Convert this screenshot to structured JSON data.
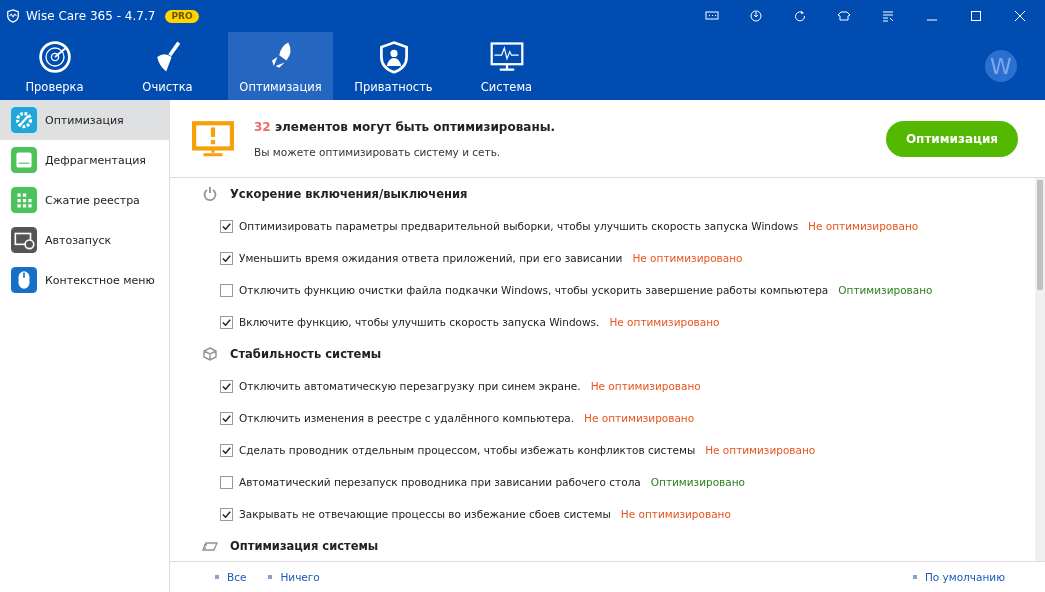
{
  "window": {
    "title": "Wise Care 365 - 4.7.7",
    "badge": "PRO"
  },
  "nav": [
    {
      "label": "Проверка",
      "selected": false
    },
    {
      "label": "Очистка",
      "selected": false
    },
    {
      "label": "Оптимизация",
      "selected": true
    },
    {
      "label": "Приватность",
      "selected": false
    },
    {
      "label": "Система",
      "selected": false
    }
  ],
  "avatar": {
    "letter": "W"
  },
  "sidebar": {
    "items": [
      {
        "label": "Оптимизация",
        "color": "#1ea7d8",
        "selected": true
      },
      {
        "label": "Дефрагментация",
        "color": "#4cc35a",
        "selected": false
      },
      {
        "label": "Сжатие реестра",
        "color": "#4cc35a",
        "selected": false
      },
      {
        "label": "Автозапуск",
        "color": "#555555",
        "selected": false
      },
      {
        "label": "Контекстное меню",
        "color": "#1670c8",
        "selected": false
      }
    ]
  },
  "header": {
    "count": "32",
    "message": "элементов могут быть оптимизированы.",
    "subtitle": "Вы можете оптимизировать систему и сеть.",
    "button": "Оптимизация"
  },
  "sections": [
    {
      "title": "Ускорение включения/выключения",
      "items": [
        {
          "label": "Оптимизировать параметры предварительной выборки, чтобы улучшить скорость запуска Windows",
          "checked": true,
          "optimized": false,
          "status": "Не оптимизировано"
        },
        {
          "label": "Уменьшить время ожидания ответа приложений, при его зависании",
          "checked": true,
          "optimized": false,
          "status": "Не оптимизировано"
        },
        {
          "label": "Отключить функцию очистки файла подкачки Windows, чтобы ускорить завершение работы компьютера",
          "checked": false,
          "optimized": true,
          "status": "Оптимизировано"
        },
        {
          "label": "Включите функцию, чтобы улучшить скорость запуска Windows.",
          "checked": true,
          "optimized": false,
          "status": "Не оптимизировано"
        }
      ]
    },
    {
      "title": "Стабильность системы",
      "items": [
        {
          "label": "Отключить автоматическую перезагрузку при синем экране.",
          "checked": true,
          "optimized": false,
          "status": "Не оптимизировано"
        },
        {
          "label": "Отключить изменения в реестре с удалённого компьютера.",
          "checked": true,
          "optimized": false,
          "status": "Не оптимизировано"
        },
        {
          "label": "Сделать проводник отдельным процессом, чтобы избежать конфликтов системы",
          "checked": true,
          "optimized": false,
          "status": "Не оптимизировано"
        },
        {
          "label": "Автоматический перезапуск проводника при зависании рабочего стола",
          "checked": false,
          "optimized": true,
          "status": "Оптимизировано"
        },
        {
          "label": "Закрывать не отвечающие процессы во избежание сбоев системы",
          "checked": true,
          "optimized": false,
          "status": "Не оптимизировано"
        }
      ]
    },
    {
      "title": "Оптимизация системы"
    }
  ],
  "footer": {
    "links": [
      "Все",
      "Ничего"
    ],
    "right": "По умолчанию"
  }
}
